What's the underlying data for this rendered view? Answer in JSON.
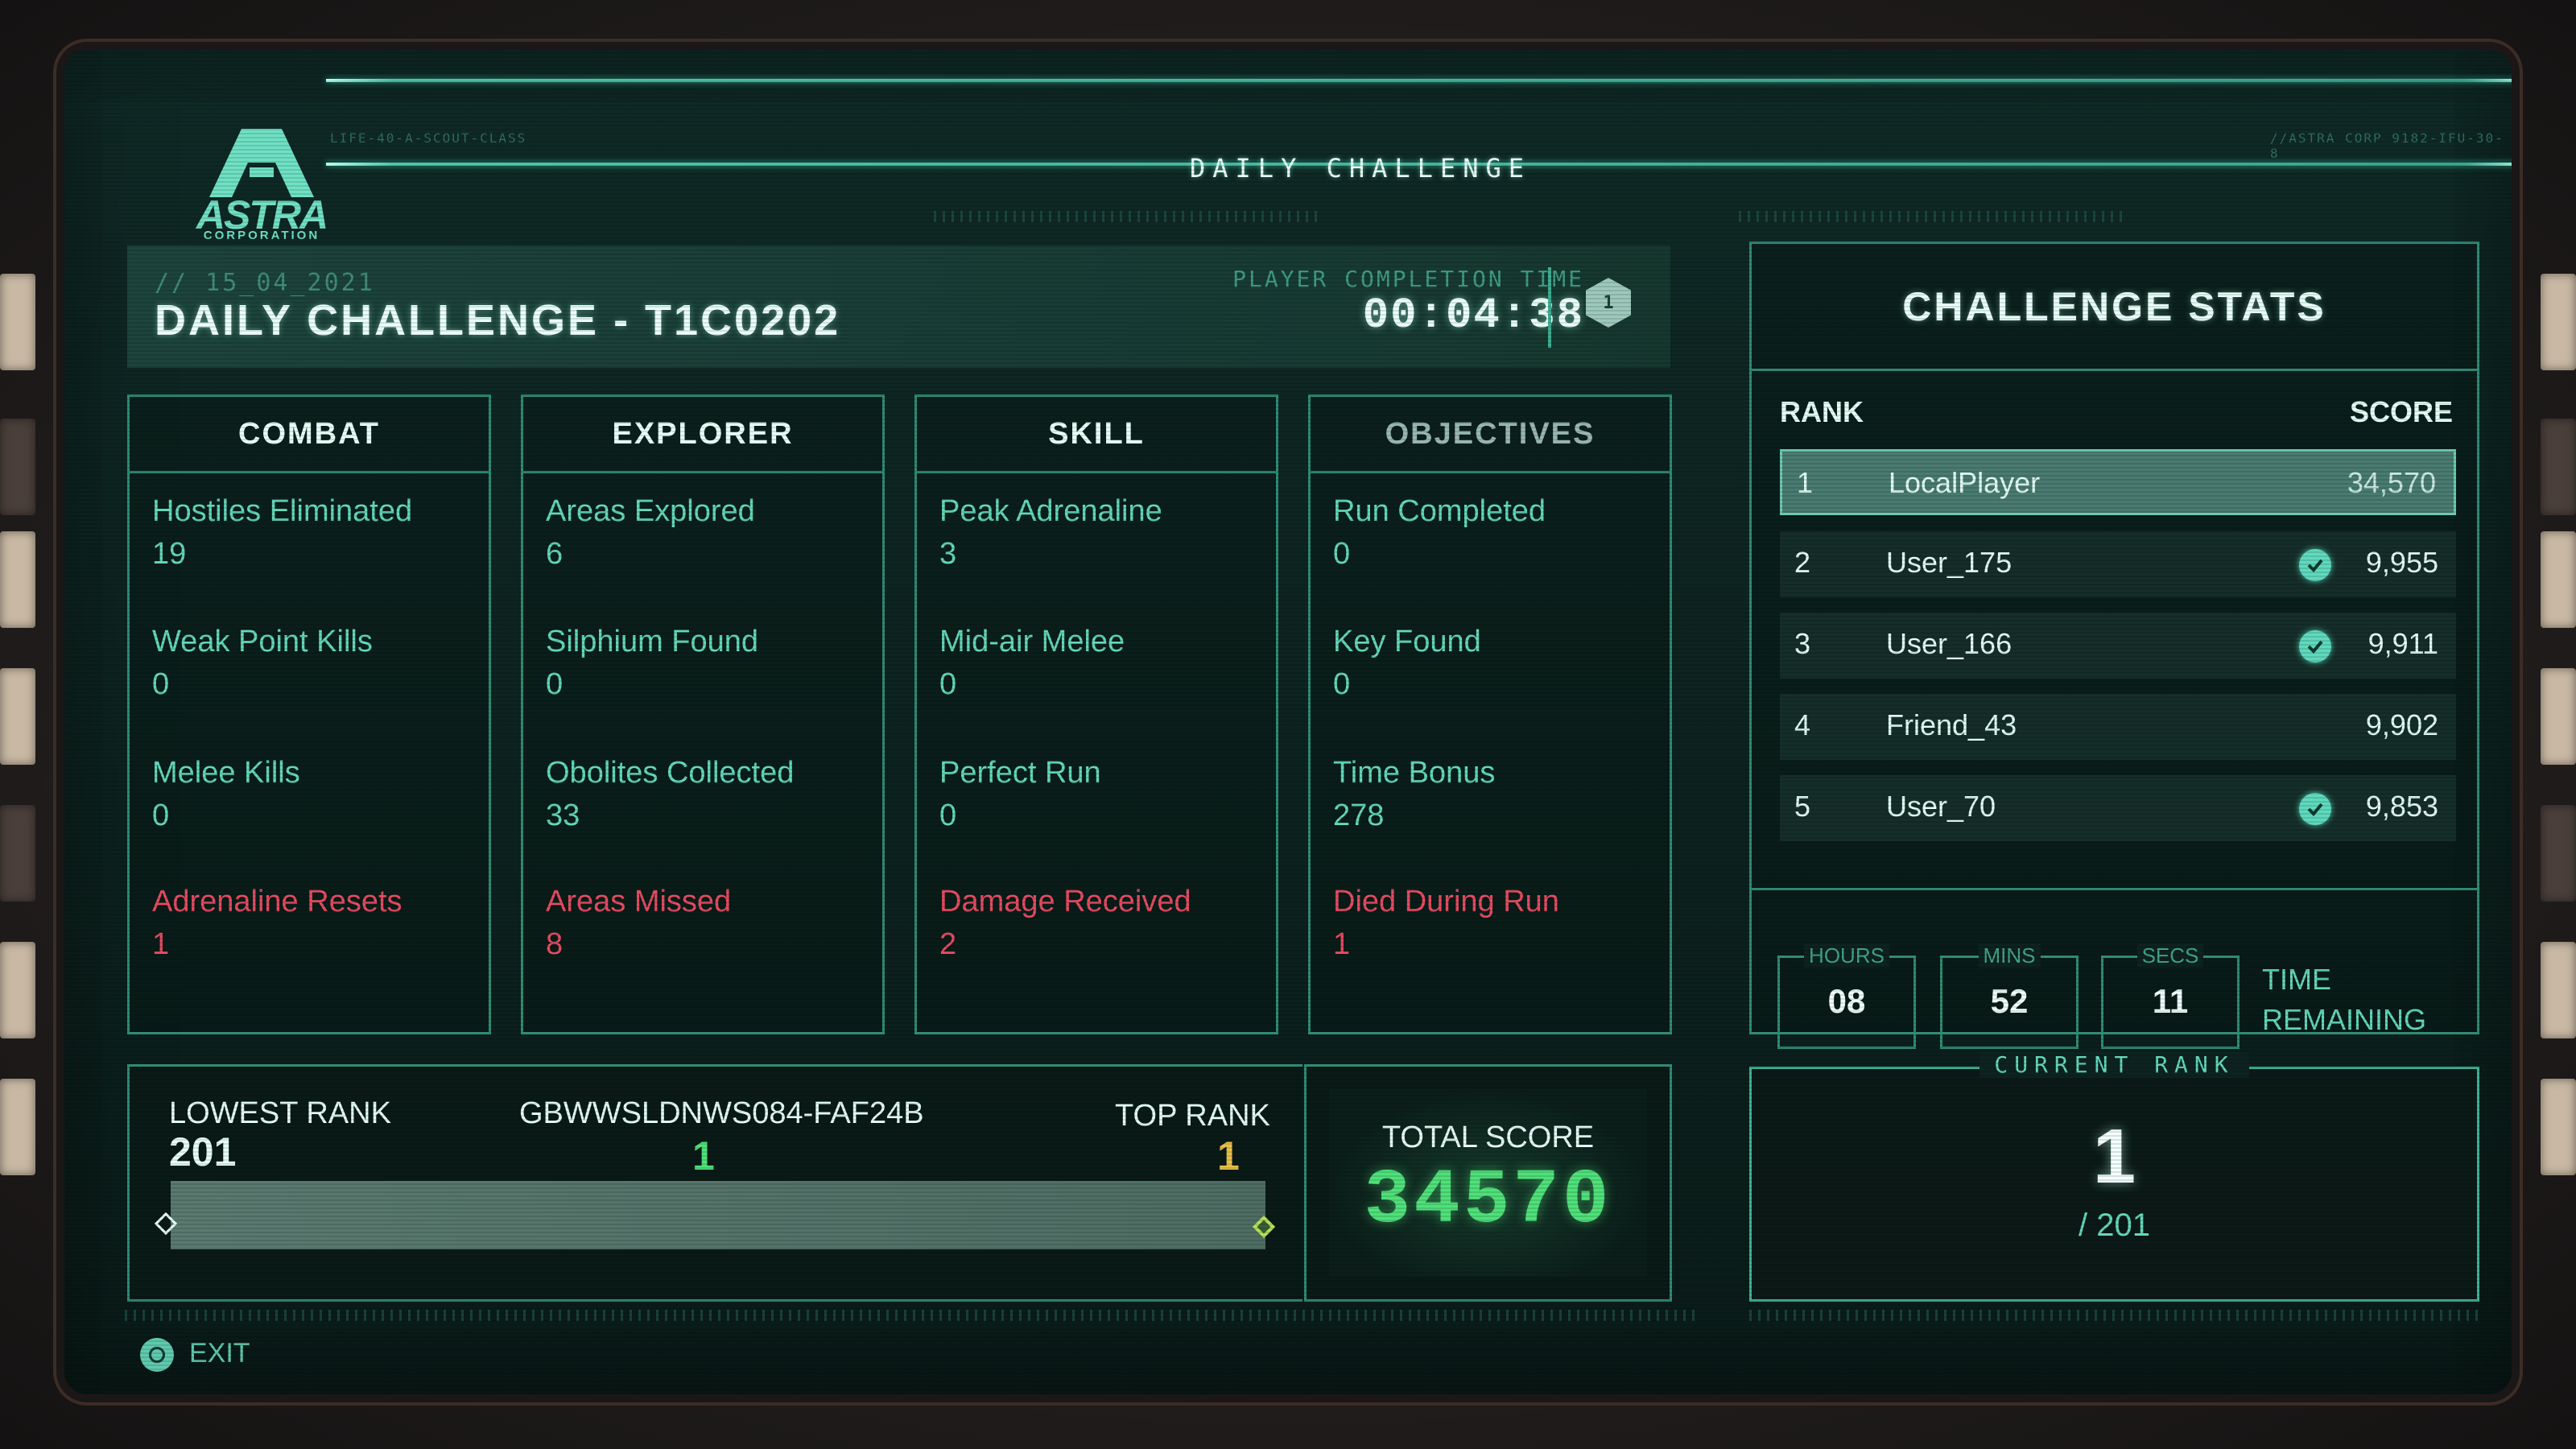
{
  "brand": {
    "name": "ASTRA",
    "subtitle": "CORPORATION",
    "code_left": "LIFE-40-A-SCOUT-CLASS",
    "code_right": "//ASTRA CORP 9182-IFU-30-8"
  },
  "header": {
    "title": "DAILY CHALLENGE"
  },
  "challenge": {
    "date": "// 15_04_2021",
    "title": "DAILY CHALLENGE - T1C0202",
    "completion_time_label": "PLAYER COMPLETION TIME",
    "completion_time": "00:04:38",
    "rank_badge": "1"
  },
  "columns": [
    {
      "title": "COMBAT",
      "stats": [
        {
          "label": "Hostiles Eliminated",
          "value": "19",
          "negative": false
        },
        {
          "label": "Weak Point Kills",
          "value": "0",
          "negative": false
        },
        {
          "label": "Melee Kills",
          "value": "0",
          "negative": false
        },
        {
          "label": "Adrenaline Resets",
          "value": "1",
          "negative": true
        }
      ]
    },
    {
      "title": "EXPLORER",
      "stats": [
        {
          "label": "Areas Explored",
          "value": "6",
          "negative": false
        },
        {
          "label": "Silphium Found",
          "value": "0",
          "negative": false
        },
        {
          "label": "Obolites Collected",
          "value": "33",
          "negative": false
        },
        {
          "label": "Areas Missed",
          "value": "8",
          "negative": true
        }
      ]
    },
    {
      "title": "SKILL",
      "stats": [
        {
          "label": "Peak Adrenaline",
          "value": "3",
          "negative": false
        },
        {
          "label": "Mid-air Melee",
          "value": "0",
          "negative": false
        },
        {
          "label": "Perfect Run",
          "value": "0",
          "negative": false
        },
        {
          "label": "Damage Received",
          "value": "2",
          "negative": true
        }
      ]
    },
    {
      "title": "OBJECTIVES",
      "stats": [
        {
          "label": "Run Completed",
          "value": "0",
          "negative": false
        },
        {
          "label": "Key Found",
          "value": "0",
          "negative": false
        },
        {
          "label": "Time Bonus",
          "value": "278",
          "negative": false
        },
        {
          "label": "Died During Run",
          "value": "1",
          "negative": true
        }
      ]
    }
  ],
  "rank_bar": {
    "lowest_label": "LOWEST RANK",
    "lowest_value": "201",
    "player_id": "GBWWSLDNWS084-FAF24B",
    "player_rank": "1",
    "top_label": "TOP RANK",
    "top_value": "1",
    "player_position_fraction": 1.0
  },
  "total_score": {
    "label": "TOTAL SCORE",
    "value": "34570"
  },
  "leaderboard": {
    "title": "CHALLENGE STATS",
    "rank_header": "RANK",
    "score_header": "SCORE",
    "rows": [
      {
        "rank": "1",
        "name": "LocalPlayer",
        "score": "34,570",
        "verified": false,
        "is_player": true
      },
      {
        "rank": "2",
        "name": "User_175",
        "score": "9,955",
        "verified": true,
        "is_player": false
      },
      {
        "rank": "3",
        "name": "User_166",
        "score": "9,911",
        "verified": true,
        "is_player": false
      },
      {
        "rank": "4",
        "name": "Friend_43",
        "score": "9,902",
        "verified": false,
        "is_player": false
      },
      {
        "rank": "5",
        "name": "User_70",
        "score": "9,853",
        "verified": true,
        "is_player": false
      }
    ]
  },
  "time_remaining": {
    "hours_label": "HOURS",
    "hours": "08",
    "mins_label": "MINS",
    "mins": "52",
    "secs_label": "SECS",
    "secs": "11",
    "label_line1": "TIME",
    "label_line2": "REMAINING"
  },
  "current_rank": {
    "label": "CURRENT RANK",
    "rank": "1",
    "total": "/ 201"
  },
  "footer": {
    "exit_label": "EXIT"
  },
  "colors": {
    "accent": "#63d8bb",
    "negative": "#e84b62",
    "score_green": "#4fe07a",
    "top_rank_gold": "#e8c04a"
  }
}
